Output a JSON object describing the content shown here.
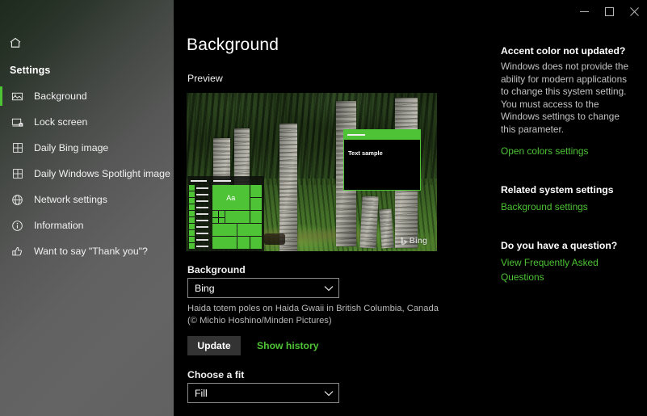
{
  "window": {
    "controls": [
      {
        "name": "minimize",
        "glyph": "minimize-icon"
      },
      {
        "name": "maximize",
        "glyph": "maximize-icon"
      },
      {
        "name": "close",
        "glyph": "close-icon"
      }
    ]
  },
  "sidebar": {
    "home_icon": "home-icon",
    "heading": "Settings",
    "accent_color": "#4dc335",
    "items": [
      {
        "label": "Background",
        "icon": "picture-icon",
        "selected": true
      },
      {
        "label": "Lock screen",
        "icon": "lock-screen-icon",
        "selected": false
      },
      {
        "label": "Daily Bing image",
        "icon": "tiles-icon",
        "selected": false
      },
      {
        "label": "Daily Windows Spotlight image",
        "icon": "tiles-icon",
        "selected": false
      },
      {
        "label": "Network settings",
        "icon": "globe-icon",
        "selected": false
      },
      {
        "label": "Information",
        "icon": "info-circle-icon",
        "selected": false
      },
      {
        "label": "Want to say \"Thank you\"?",
        "icon": "thumbs-up-icon",
        "selected": false
      }
    ]
  },
  "main": {
    "page_title": "Background",
    "preview_label": "Preview",
    "preview": {
      "start_menu_tile_text": "Aa",
      "sample_window_text": "Text sample",
      "watermark": "Bing",
      "watermark_icon": "bing-logo-icon",
      "accent_color": "#4dc335"
    },
    "background_field": {
      "label": "Background",
      "value": "Bing",
      "chevron_icon": "chevron-down-icon"
    },
    "credit": "Haida totem poles on Haida Gwaii in British Columbia, Canada (© Michio Hoshino/Minden Pictures)",
    "update_button": "Update",
    "show_history_link": "Show history",
    "fit_field": {
      "label": "Choose a fit",
      "value": "Fill",
      "chevron_icon": "chevron-down-icon"
    }
  },
  "help": {
    "blocks": [
      {
        "heading": "Accent color not updated?",
        "body": "Windows does not provide the ability for modern applications to change this system setting. You must access to the Windows settings to change this parameter.",
        "link": "Open colors settings"
      },
      {
        "heading": "Related system settings",
        "body": "",
        "link": "Background settings"
      },
      {
        "heading": "Do you have a question?",
        "body": "",
        "link": "View Frequently Asked Questions"
      }
    ],
    "link_color": "#4dc335"
  }
}
